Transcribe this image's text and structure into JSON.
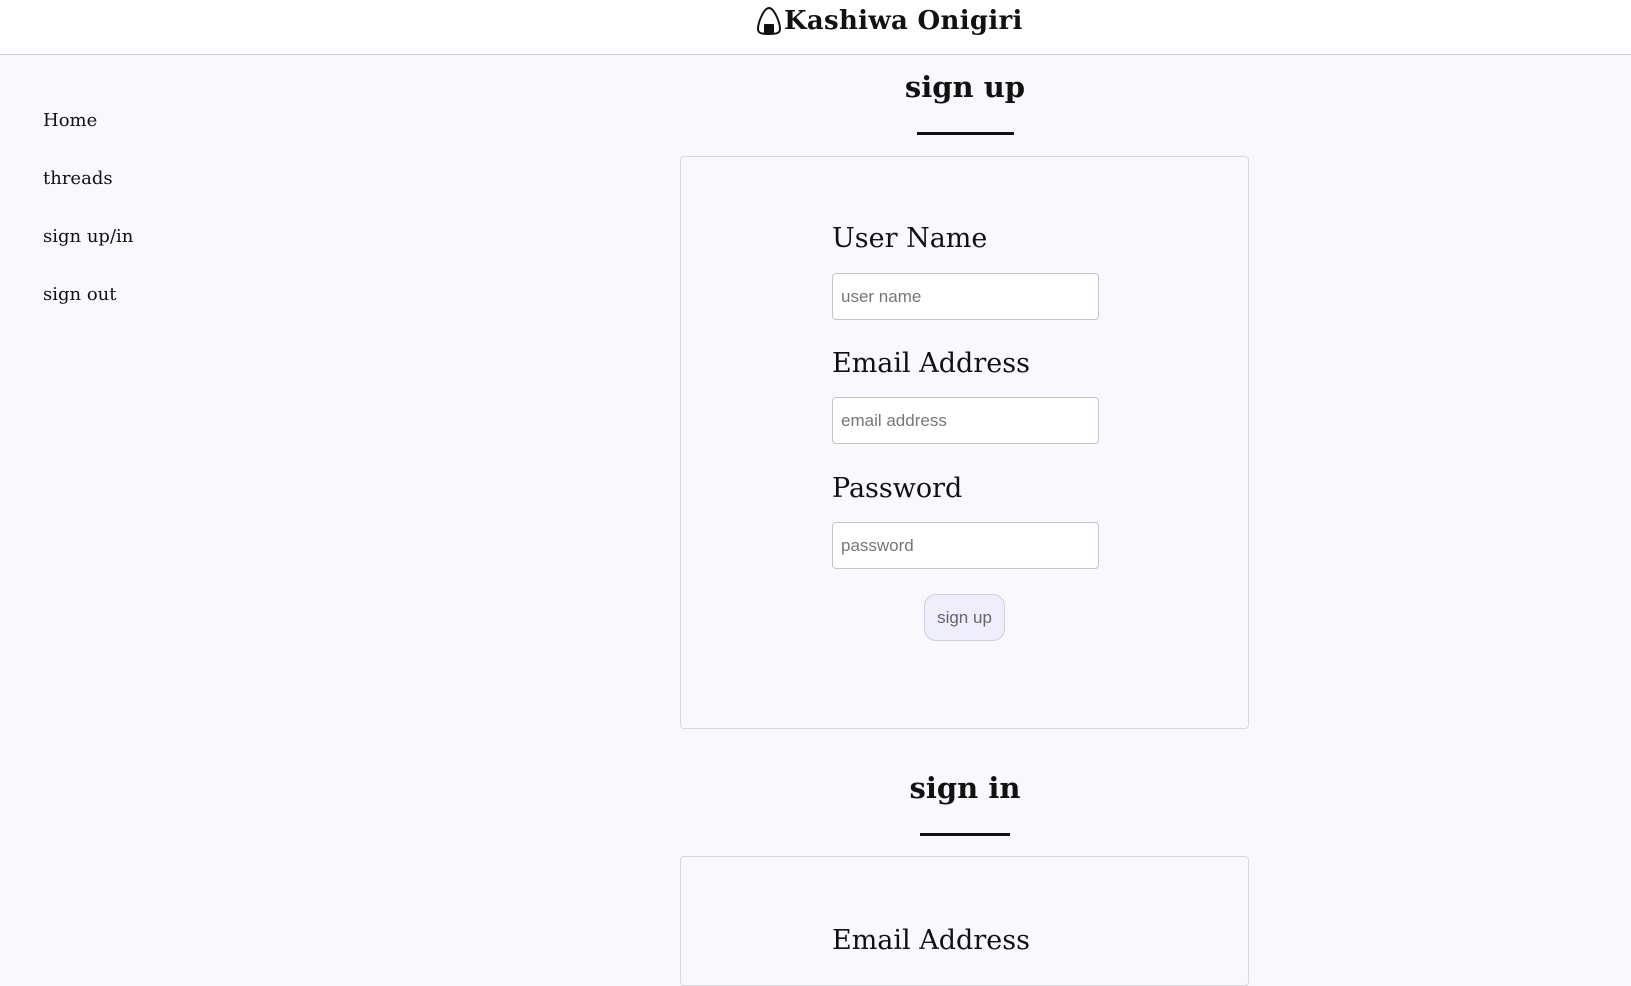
{
  "header": {
    "brand_name": "Kashiwa Onigiri",
    "logo_icon": "onigiri-icon"
  },
  "sidebar": {
    "items": [
      {
        "label": "Home"
      },
      {
        "label": "threads"
      },
      {
        "label": "sign up/in"
      },
      {
        "label": "sign out"
      }
    ]
  },
  "signup": {
    "title": "sign up",
    "fields": [
      {
        "label": "User Name",
        "placeholder": "user name",
        "value": ""
      },
      {
        "label": "Email Address",
        "placeholder": "email address",
        "value": ""
      },
      {
        "label": "Password",
        "placeholder": "password",
        "value": ""
      }
    ],
    "button_label": "sign up"
  },
  "signin": {
    "title": "sign in",
    "fields": [
      {
        "label": "Email Address"
      }
    ]
  },
  "colors": {
    "page_background": "#f8f8fd",
    "header_background": "#ffffff",
    "button_background": "#eeeefc",
    "text": "#111111"
  }
}
